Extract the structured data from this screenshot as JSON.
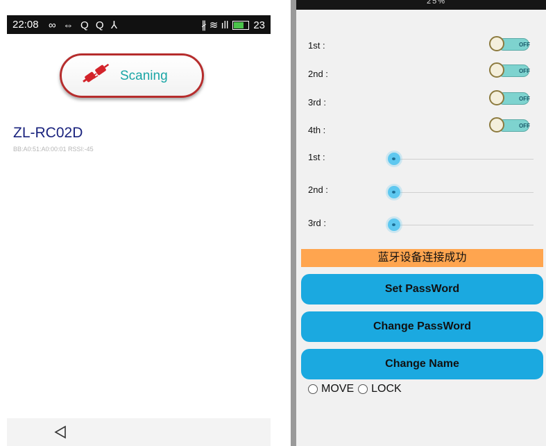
{
  "left_screen": {
    "status_bar": {
      "time": "22:08",
      "left_icons": "∞ ⇔ Q Q ⅄",
      "right_icons": "∦ ≋ ıll",
      "battery_text": "23"
    },
    "scan_button_label": "Scaning",
    "device": {
      "name": "ZL-RC02D",
      "info": "BB:A0:51:A0:00:01  RSSI:-45"
    },
    "nav": {
      "back_glyph": "◁"
    }
  },
  "right_screen": {
    "status_bar_text": "25%",
    "toggles": [
      {
        "label": "1st :",
        "state": "OFF"
      },
      {
        "label": "2nd :",
        "state": "OFF"
      },
      {
        "label": "3rd :",
        "state": "OFF"
      },
      {
        "label": "4th :",
        "state": "OFF"
      }
    ],
    "sliders": [
      {
        "label": "1st :",
        "value": 0
      },
      {
        "label": "2nd :",
        "value": 0
      },
      {
        "label": "3rd :",
        "value": 0
      }
    ],
    "banner_text": "蓝牙设备连接成功",
    "buttons": {
      "set_password": "Set PassWord",
      "change_password": "Change PassWord",
      "change_name": "Change Name"
    },
    "radios": [
      {
        "label": "MOVE",
        "checked": false
      },
      {
        "label": "LOCK",
        "checked": false
      }
    ],
    "colors": {
      "banner": "#ffa54f",
      "button": "#1ba9e0",
      "scan_border": "#b62d2d",
      "scan_text": "#1aa6a6",
      "device_name": "#1a237e"
    }
  }
}
